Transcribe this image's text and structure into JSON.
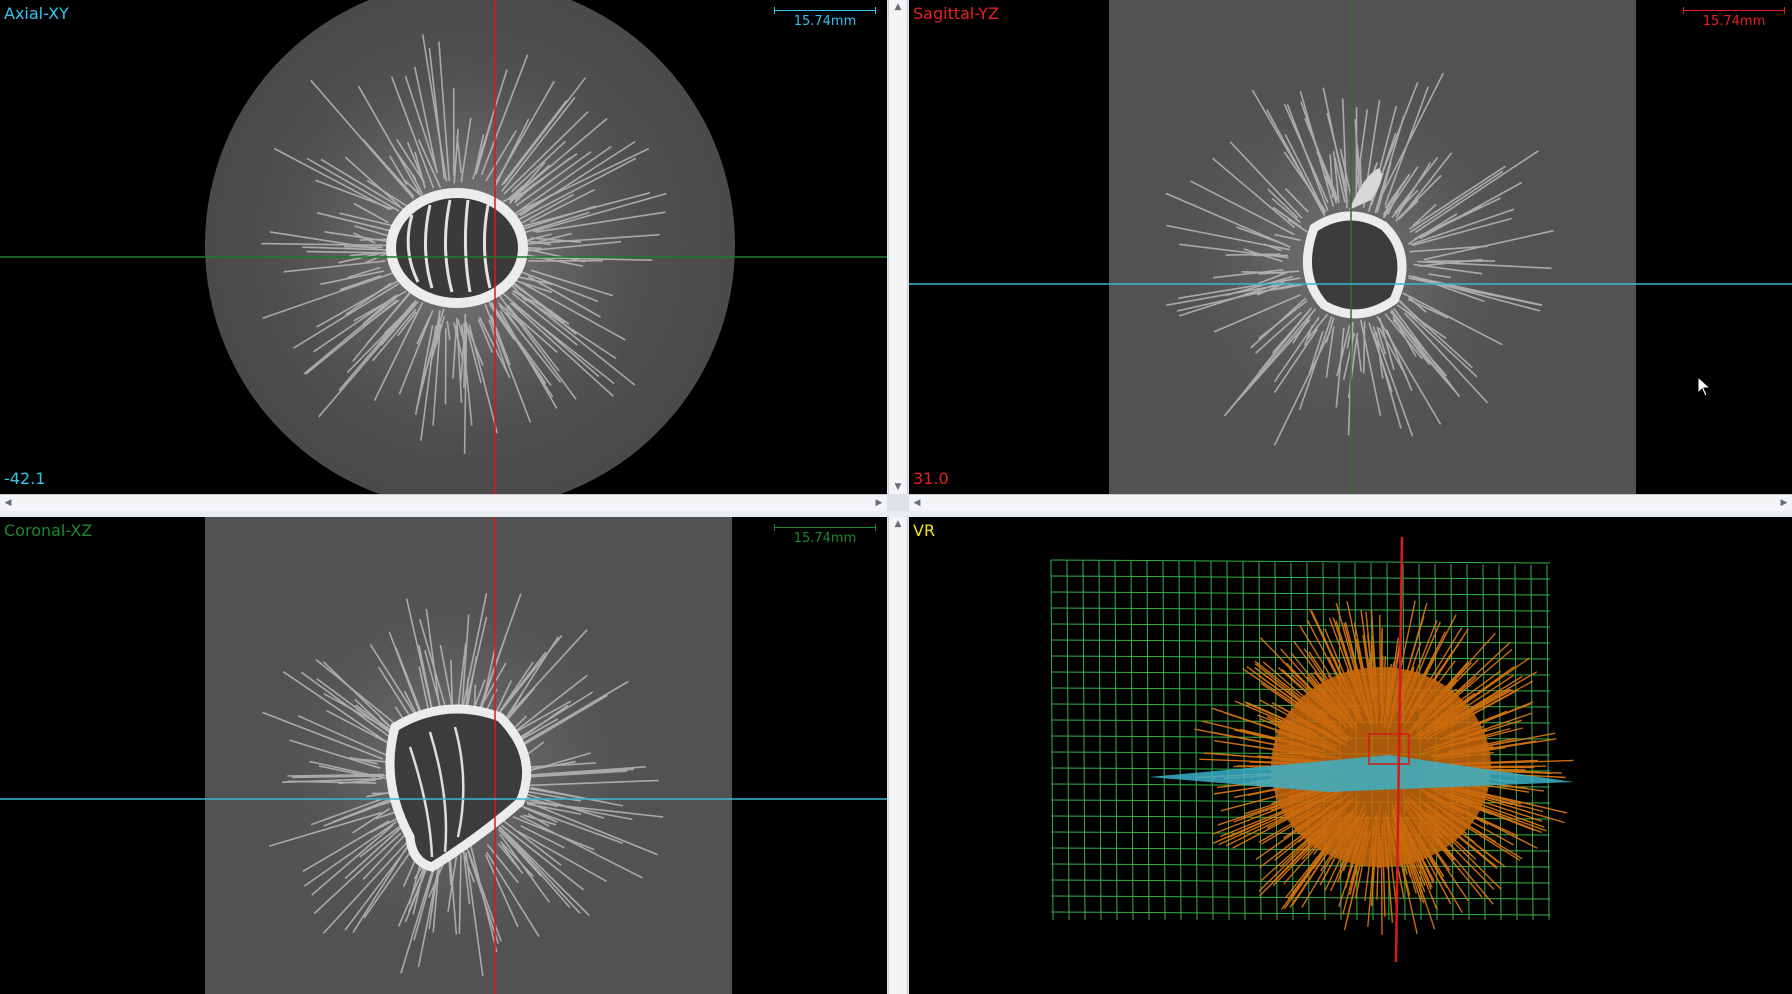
{
  "viewports": {
    "axial": {
      "title": "Axial-XY",
      "slice_value": "-42.1",
      "scale_label": "15.74mm",
      "color": "#34c3f0"
    },
    "sagittal": {
      "title": "Sagittal-YZ",
      "slice_value": "31.0",
      "scale_label": "15.74mm",
      "color": "#e8201e"
    },
    "coronal": {
      "title": "Coronal-XZ",
      "slice_value": "",
      "scale_label": "15.74mm",
      "color": "#1c8a2c"
    },
    "vr": {
      "title": "VR",
      "color": "#f2e21c"
    }
  },
  "colors": {
    "crosshair_red": "#d81a1a",
    "crosshair_green": "#1f7a2a",
    "crosshair_cyan": "#3ab7d3",
    "volume_orange": "#e07a10",
    "grid_green": "#33b04a",
    "plane_cyan": "#3ab0c8"
  },
  "icons": {
    "scroll_left": "◀",
    "scroll_right": "▶",
    "scroll_up": "▲",
    "scroll_down": "▼"
  }
}
